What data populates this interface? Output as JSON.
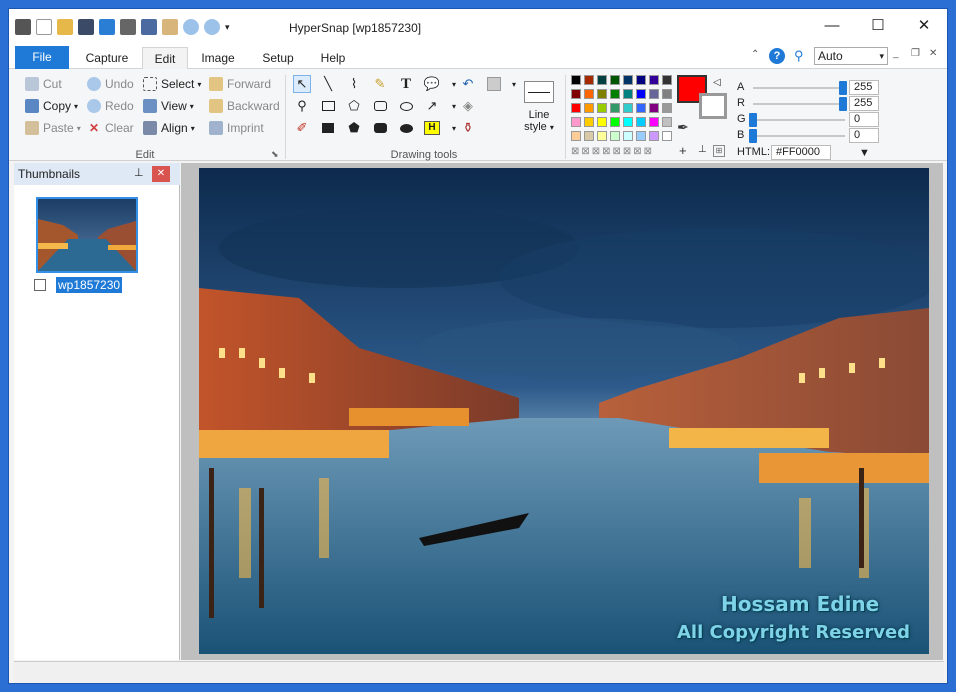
{
  "window": {
    "title": "HyperSnap [wp1857230]"
  },
  "menu": {
    "tabs": [
      "File",
      "Capture",
      "Edit",
      "Image",
      "Setup",
      "Help"
    ],
    "zoom_value": "Auto"
  },
  "ribbon": {
    "edit_group": {
      "label": "Edit",
      "cut": "Cut",
      "copy": "Copy",
      "paste": "Paste",
      "undo": "Undo",
      "redo": "Redo",
      "clear": "Clear",
      "select": "Select",
      "view": "View",
      "align": "Align",
      "forward": "Forward",
      "backward": "Backward",
      "imprint": "Imprint"
    },
    "drawing_group": {
      "label": "Drawing tools",
      "line_style": "Line style",
      "highlight_glyph": "H",
      "text_glyph": "T"
    },
    "color_group": {
      "a_label": "A",
      "r_label": "R",
      "g_label": "G",
      "b_label": "B",
      "a_value": "255",
      "r_value": "255",
      "g_value": "0",
      "b_value": "0",
      "html_label": "HTML:",
      "html_value": "#FF0000"
    }
  },
  "colors": {
    "accent": "#1e7ad6",
    "current": "#ff0000"
  },
  "palette": [
    [
      "#000000",
      "#a52a00",
      "#004040",
      "#005500",
      "#003366",
      "#000080",
      "#330099",
      "#333333"
    ],
    [
      "#800000",
      "#ff6600",
      "#808000",
      "#008000",
      "#008080",
      "#0000ff",
      "#666699",
      "#808080"
    ],
    [
      "#ff0000",
      "#ff9900",
      "#99cc00",
      "#339966",
      "#33cccc",
      "#3366ff",
      "#800080",
      "#999999"
    ],
    [
      "#ff99cc",
      "#ffcc00",
      "#ffff00",
      "#00ff00",
      "#00ffff",
      "#00ccff",
      "#ff00ff",
      "#c0c0c0"
    ],
    [
      "#ffcc99",
      "#d8c9a8",
      "#ffff99",
      "#ccffcc",
      "#ccffff",
      "#99ccff",
      "#cc99ff",
      "#ffffff"
    ]
  ],
  "thumbnails": {
    "title": "Thumbnails",
    "items": [
      {
        "label": "wp1857230"
      }
    ]
  },
  "watermark": {
    "line1": "Hossam Edine",
    "line2": "All Copyright Reserved"
  }
}
